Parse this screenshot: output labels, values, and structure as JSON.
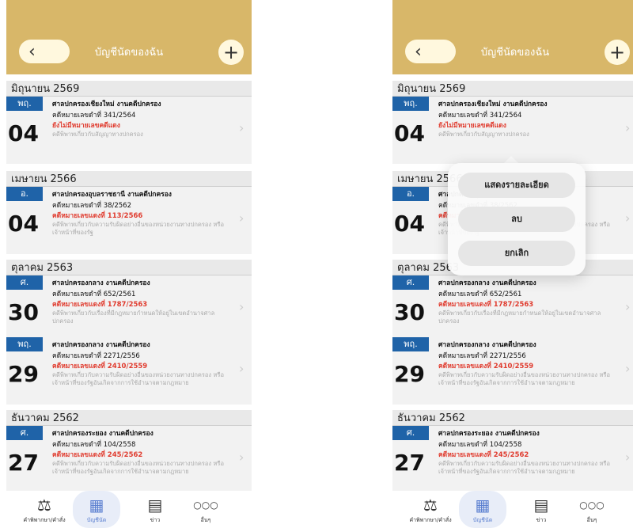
{
  "header": {
    "back_icon": "‹",
    "title": "บัญชีนัดของฉัน",
    "add_icon": "+"
  },
  "months": [
    "มิถุนายน 2569",
    "เมษายน 2566",
    "ตุลาคม 2563",
    "ธันวาคม 2562"
  ],
  "entries": [
    {
      "badge": "พฤ.",
      "day": "04",
      "court": "ศาลปกครองเชียงใหม่ งานคดีปกครอง",
      "black_case": "คดีหมายเลขดำที่ 341/2564",
      "red_case": "ยังไม่มีหมายเลขคดีแดง",
      "desc": "คดีพิพาทเกี่ยวกับสัญญาทางปกครอง"
    },
    {
      "badge": "อ.",
      "day": "04",
      "court": "ศาลปกครองอุบลราชธานี งานคดีปกครอง",
      "black_case": "คดีหมายเลขดำที่ 38/2562",
      "red_case": "คดีหมายเลขแดงที่ 113/2566",
      "desc": "คดีพิพาทเกี่ยวกับความรับผิดอย่างอื่นของหน่วยงานทางปกครอง หรือเจ้าหน้าที่ของรัฐ"
    },
    {
      "badge": "ศ.",
      "day": "30",
      "court": "ศาลปกครองกลาง งานคดีปกครอง",
      "black_case": "คดีหมายเลขดำที่ 652/2561",
      "red_case": "คดีหมายเลขแดงที่ 1787/2563",
      "desc": "คดีพิพาทเกี่ยวกับเรื่องที่มีกฎหมายกำหนดให้อยู่ในเขตอำนาจศาลปกครอง"
    },
    {
      "badge": "พฤ.",
      "day": "29",
      "court": "ศาลปกครองกลาง งานคดีปกครอง",
      "black_case": "คดีหมายเลขดำที่ 2271/2556",
      "red_case": "คดีหมายเลขแดงที่ 2410/2559",
      "desc": "คดีพิพาทเกี่ยวกับความรับผิดอย่างอื่นของหน่วยงานทางปกครอง หรือเจ้าหน้าที่ของรัฐอันเกิดจากการใช้อำนาจตามกฎหมาย"
    },
    {
      "badge": "ศ.",
      "day": "27",
      "court": "ศาลปกครองระยอง งานคดีปกครอง",
      "black_case": "คดีหมายเลขดำที่ 104/2558",
      "red_case": "คดีหมายเลขแดงที่ 245/2562",
      "desc": "คดีพิพาทเกี่ยวกับความรับผิดอย่างอื่นของหน่วยงานทางปกครอง หรือเจ้าหน้าที่ของรัฐอันเกิดจากการใช้อำนาจตามกฎหมาย"
    }
  ],
  "tabs": [
    {
      "label": "คำพิพากษา/คำสั่ง",
      "icon": "gavel-icon"
    },
    {
      "label": "บัญชีนัด",
      "icon": "calendar-icon"
    },
    {
      "label": "ข่าว",
      "icon": "news-icon"
    },
    {
      "label": "อื่นๆ",
      "icon": "more-icon"
    }
  ],
  "popup": {
    "details": "แสดงรายละเอียด",
    "delete": "ลบ",
    "cancel": "ยกเลิก"
  },
  "colors": {
    "header": "#d8b769",
    "badge": "#1f63a8",
    "red_case": "#e03b2e",
    "active_tab": "#5a7fd0"
  }
}
